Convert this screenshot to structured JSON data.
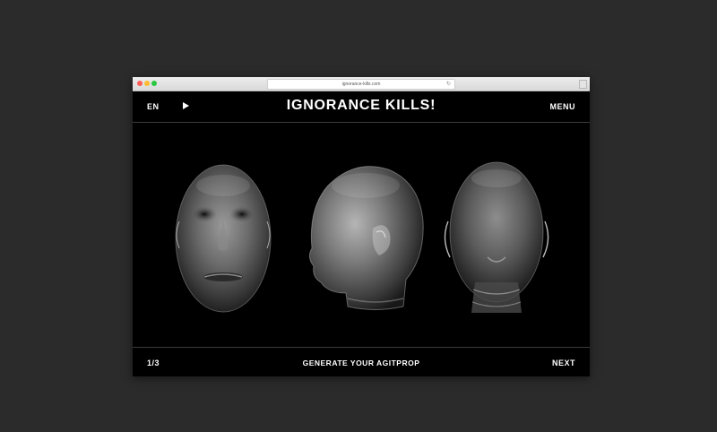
{
  "browser": {
    "url": "ignorance-kills.com",
    "reload_icon": "reload-icon"
  },
  "header": {
    "language": "EN",
    "play_icon": "play-icon",
    "title": "IGNORANCE KILLS!",
    "menu": "MENU"
  },
  "stage": {
    "images": [
      "glass-head-front",
      "glass-head-profile",
      "glass-head-back"
    ]
  },
  "footer": {
    "counter": "1/3",
    "cta": "GENERATE YOUR AGITPROP",
    "next": "NEXT"
  },
  "colors": {
    "background": "#2b2b2b",
    "site_background": "#000000",
    "text": "#ffffff"
  }
}
